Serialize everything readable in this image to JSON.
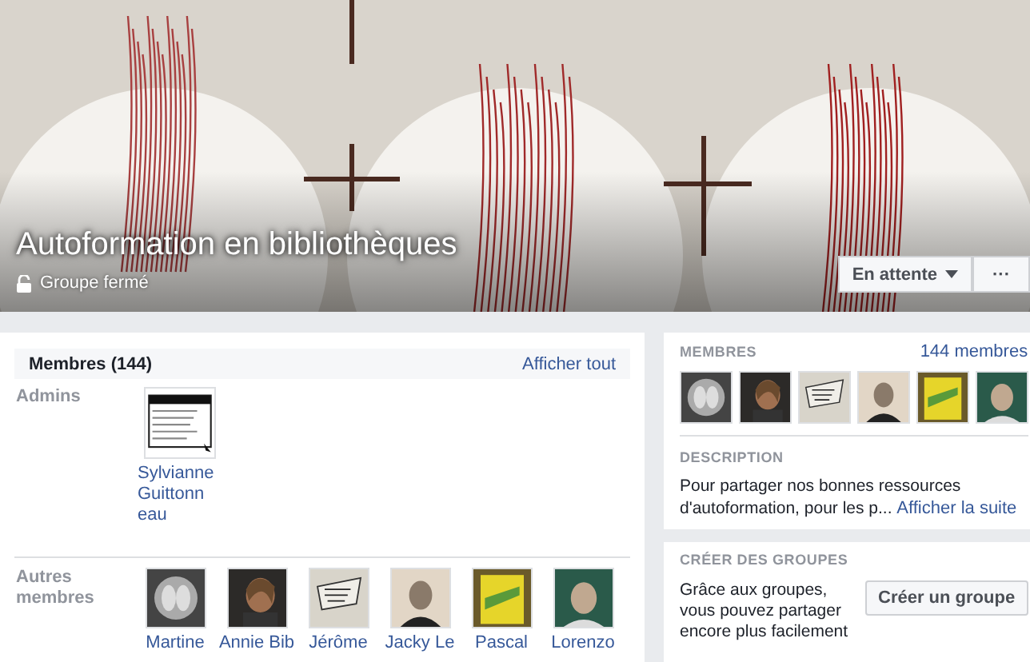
{
  "cover": {
    "title": "Autoformation en bibliothèques",
    "privacy": "Groupe fermé",
    "join_button": "En attente",
    "more_button": "···"
  },
  "members_card": {
    "title": "Membres (144)",
    "link": "Afficher tout",
    "admins_label": "Admins",
    "admins": [
      {
        "name": "Sylvianne Guittonn eau"
      }
    ],
    "others_label": "Autres membres",
    "others": [
      {
        "name": "Martine"
      },
      {
        "name": "Annie Bib"
      },
      {
        "name": "Jérôme"
      },
      {
        "name": "Jacky Le"
      },
      {
        "name": "Pascal"
      },
      {
        "name": "Lorenzo"
      }
    ]
  },
  "sidebar": {
    "members": {
      "heading": "MEMBRES",
      "count_link": "144 membres"
    },
    "description": {
      "heading": "DESCRIPTION",
      "text": "Pour partager nos bonnes ressources d'autoformation, pour les p...",
      "more_link": "Afficher la suite"
    },
    "create": {
      "heading": "CRÉER DES GROUPES",
      "text": "Grâce aux groupes, vous pouvez partager encore plus facilement",
      "button": "Créer un groupe"
    }
  }
}
